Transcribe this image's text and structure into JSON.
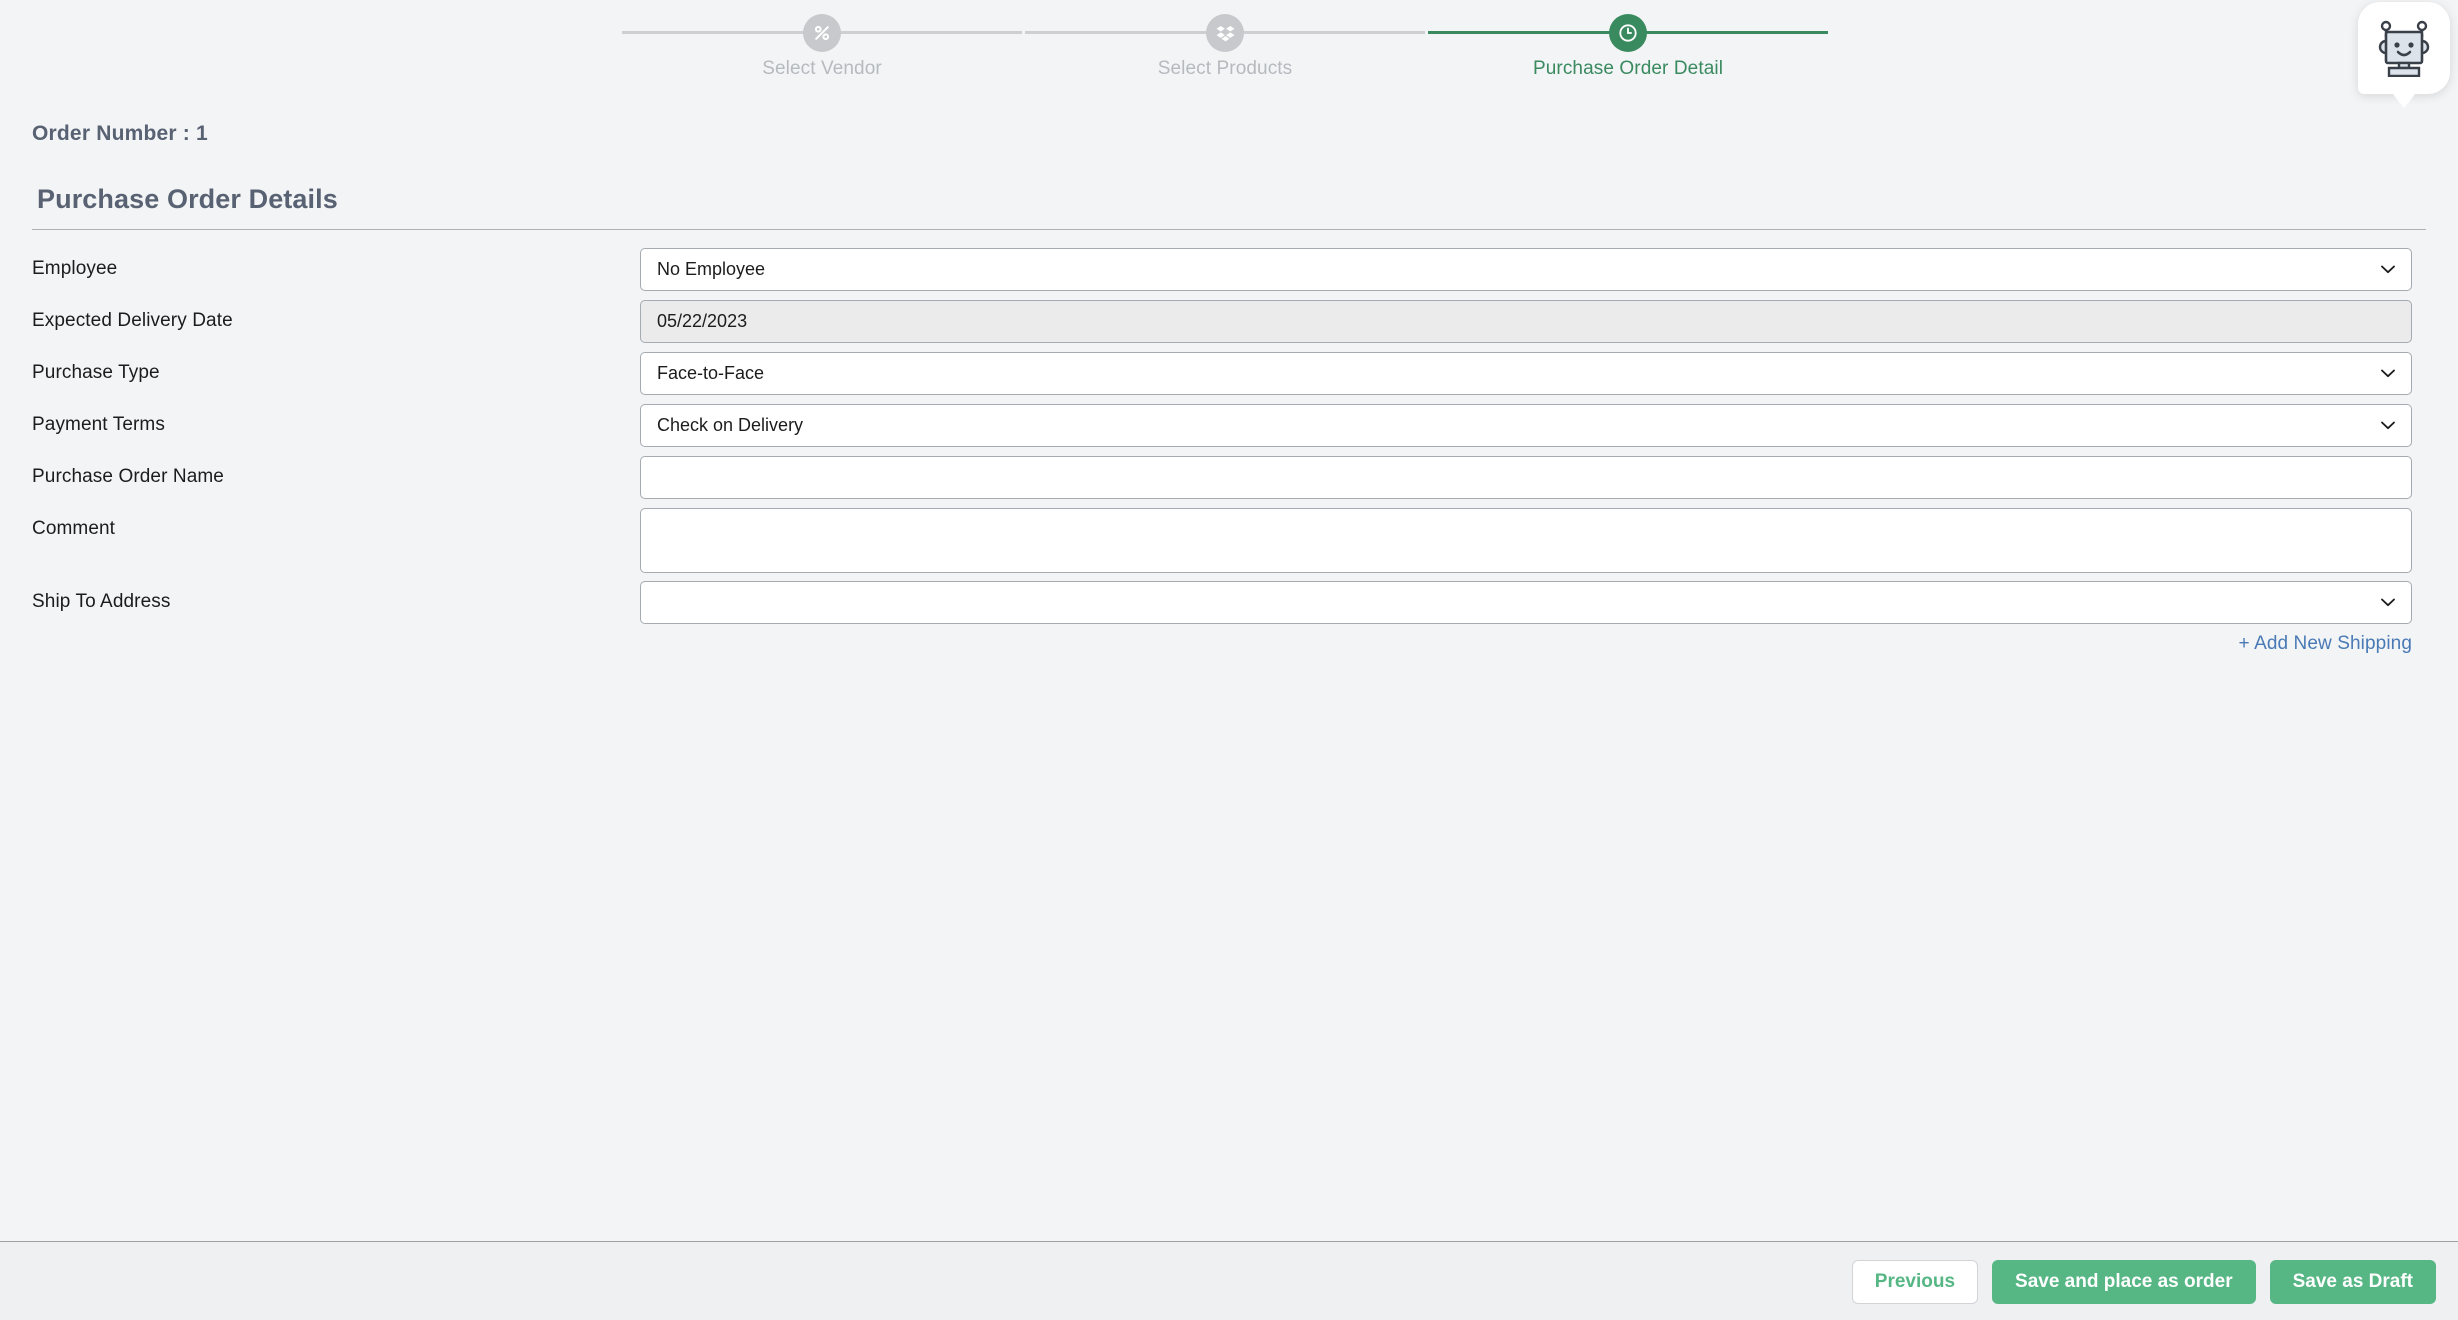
{
  "colors": {
    "page_bg": "#f2f4f6",
    "footer_bg": "#eff0f2",
    "accent_green": "#56b684",
    "step_active_green": "#3a8a60",
    "step_inactive_gray": "#c7c9cc",
    "link_blue": "#4a7ab5",
    "label_text": "#1c1c1c",
    "heading_text": "#596273"
  },
  "stepper": {
    "steps": [
      {
        "label": "Select Vendor",
        "icon": "percent-icon",
        "active": false
      },
      {
        "label": "Select Products",
        "icon": "package-icon",
        "active": false
      },
      {
        "label": "Purchase Order Detail",
        "icon": "clock-icon",
        "active": true
      }
    ]
  },
  "assistant": {
    "icon": "robot-avatar-icon"
  },
  "header": {
    "order_number": "Order Number : 1",
    "section_title": "Purchase Order Details"
  },
  "form": {
    "fields": [
      {
        "label": "Employee",
        "value": "No Employee",
        "type": "select",
        "disabled": false
      },
      {
        "label": "Expected Delivery Date",
        "value": "05/22/2023",
        "type": "date",
        "disabled": true
      },
      {
        "label": "Purchase Type",
        "value": "Face-to-Face",
        "type": "select",
        "disabled": false
      },
      {
        "label": "Payment Terms",
        "value": "Check on Delivery",
        "type": "select",
        "disabled": false
      },
      {
        "label": "Purchase Order Name",
        "value": "",
        "type": "text",
        "disabled": false,
        "placeholder": ""
      },
      {
        "label": "Comment",
        "value": "",
        "type": "textarea",
        "disabled": false,
        "placeholder": ""
      },
      {
        "label": "Ship To Address",
        "value": "",
        "type": "select",
        "disabled": false
      }
    ],
    "add_shipping_label": "+ Add New Shipping"
  },
  "footer": {
    "previous_label": "Previous",
    "save_order_label": "Save and place as order",
    "save_draft_label": "Save as Draft"
  }
}
